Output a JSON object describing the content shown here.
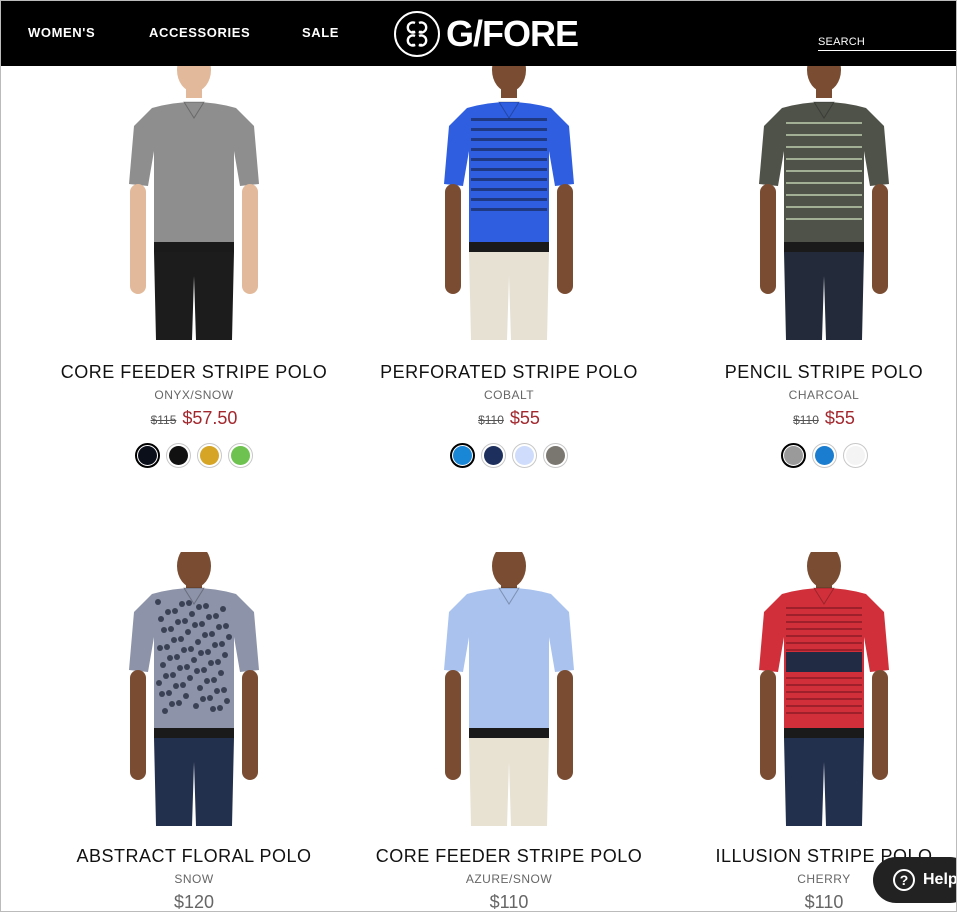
{
  "header": {
    "nav": [
      "WOMEN'S",
      "ACCESSORIES",
      "SALE"
    ],
    "logo_text": "G/FORE",
    "logo_mark": "G G G G",
    "search_placeholder": "SEARCH"
  },
  "products": [
    {
      "title": "CORE FEEDER STRIPE POLO",
      "color_name": "ONYX/SNOW",
      "old_price": "$115",
      "price": "$57.50",
      "shirt_color": "#8e8e8e",
      "pants_color": "#1c1c1c",
      "stripes": "none",
      "swatches": [
        "#0b0f1a",
        "#111111",
        "#d6a526",
        "#6ec24f"
      ]
    },
    {
      "title": "PERFORATED STRIPE POLO",
      "color_name": "COBALT",
      "old_price": "$110",
      "price": "$55",
      "shirt_color": "#2f5fe0",
      "pants_color": "#e6e1d3",
      "stripes": "navy",
      "swatches": [
        "#1a86d6",
        "#1d2f5c",
        "#cfdcfb",
        "#7a7670"
      ]
    },
    {
      "title": "PENCIL STRIPE POLO",
      "color_name": "CHARCOAL",
      "old_price": "$110",
      "price": "$55",
      "shirt_color": "#4f5249",
      "pants_color": "#232a3a",
      "stripes": "light",
      "swatches": [
        "#9a9a9a",
        "#1b7dd0",
        "#f4f4f4"
      ]
    },
    {
      "title": "ABSTRACT FLORAL POLO",
      "color_name": "SNOW",
      "old_price": "",
      "price": "$120",
      "shirt_color": "#8d93a8",
      "pants_color": "#23304d",
      "stripes": "floral",
      "swatches": []
    },
    {
      "title": "CORE FEEDER STRIPE POLO",
      "color_name": "AZURE/SNOW",
      "old_price": "",
      "price": "$110",
      "shirt_color": "#a9c2ee",
      "pants_color": "#e8e2d2",
      "stripes": "none",
      "swatches": []
    },
    {
      "title": "ILLUSION STRIPE POLO",
      "color_name": "CHERRY",
      "old_price": "",
      "price": "$110",
      "shirt_color": "#d1303a",
      "pants_color": "#23304d",
      "stripes": "band",
      "swatches": []
    }
  ],
  "help": {
    "label": "Help",
    "icon": "?"
  }
}
